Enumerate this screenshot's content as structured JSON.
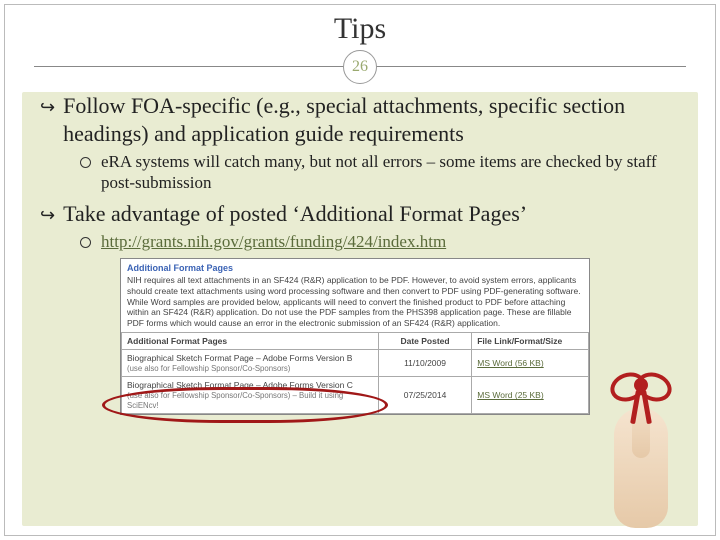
{
  "title": "Tips",
  "page_number": "26",
  "bullets": {
    "b1": "Follow FOA-specific (e.g., special attachments, specific section headings) and application guide requirements",
    "b1a": "eRA systems will catch many, but not all errors – some items are checked by staff post-submission",
    "b2": "Take advantage of posted ‘Additional Format Pages’",
    "b2a_url": "http://grants.nih.gov/grants/funding/424/index.htm"
  },
  "screenshot": {
    "heading": "Additional Format Pages",
    "intro": "NIH requires all text attachments in an SF424 (R&R) application to be PDF. However, to avoid system errors, applicants should create text attachments using word processing software and then convert to PDF using PDF-generating software. While Word samples are provided below, applicants will need to convert the finished product to PDF before attaching within an SF424 (R&R) application. Do not use the PDF samples from the PHS398 application page. These are fillable PDF forms which would cause an error in the electronic submission of an SF424 (R&R) application.",
    "section_header": "Additional Format Pages",
    "col_date": "Date Posted",
    "col_file": "File Link/Format/Size",
    "rows": [
      {
        "name": "Biographical Sketch Format Page – Adobe Forms Version B",
        "note": "(use also for Fellowship Sponsor/Co-Sponsors)",
        "date": "11/10/2009",
        "file": "MS Word  (56 KB)"
      },
      {
        "name": "Biographical Sketch Format Page – Adobe Forms Version C",
        "note": "(use also for Fellowship Sponsor/Co-Sponsors) – Build it using SciENcv!",
        "date": "07/25/2014",
        "file": "MS Word  (25 KB)"
      }
    ]
  },
  "copyright": ""
}
